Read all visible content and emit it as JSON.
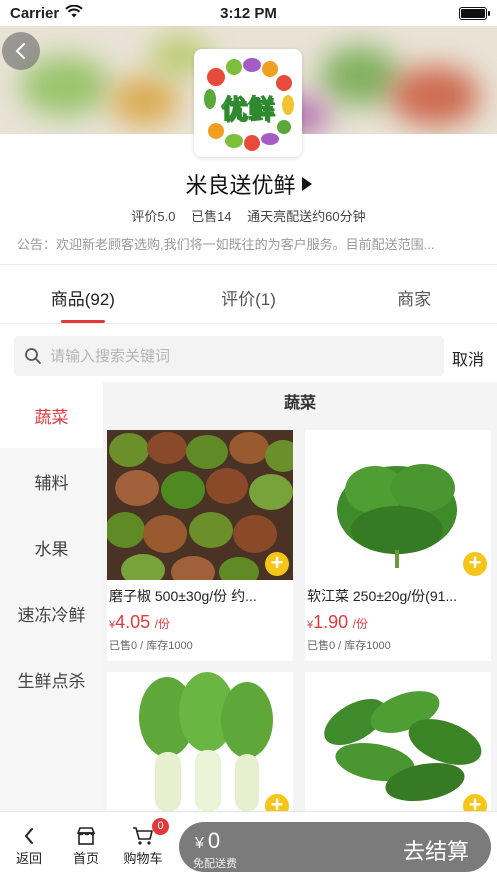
{
  "status_bar": {
    "carrier": "Carrier",
    "time": "3:12 PM"
  },
  "shop": {
    "logo_text": "优鲜",
    "name": "米良送优鲜",
    "rating": "评价5.0",
    "sold": "已售14",
    "delivery": "通天亮配送约60分钟",
    "notice": "公告：欢迎新老顾客选购,我们将一如既往的为客户服务。目前配送范围..."
  },
  "tabs": [
    {
      "label": "商品(92)",
      "active": true
    },
    {
      "label": "评价(1)",
      "active": false
    },
    {
      "label": "商家",
      "active": false
    }
  ],
  "search": {
    "placeholder": "请输入搜索关键词",
    "cancel": "取消"
  },
  "categories": [
    {
      "label": "蔬菜",
      "active": true
    },
    {
      "label": "辅料",
      "active": false
    },
    {
      "label": "水果",
      "active": false
    },
    {
      "label": "速冻冷鲜",
      "active": false
    },
    {
      "label": "生鲜点杀",
      "active": false
    }
  ],
  "current_category": "蔬菜",
  "products": [
    {
      "name": "磨子椒 500±30g/份 约...",
      "currency": "¥",
      "price": "4.05",
      "unit": "/份",
      "stock": "已售0 / 库存1000"
    },
    {
      "name": "软江菜 250±20g/份(91...",
      "currency": "¥",
      "price": "1.90",
      "unit": "/份",
      "stock": "已售0 / 库存1000"
    },
    {
      "name": "",
      "currency": "",
      "price": "",
      "unit": "",
      "stock": ""
    },
    {
      "name": "",
      "currency": "",
      "price": "",
      "unit": "",
      "stock": ""
    }
  ],
  "bottom_bar": {
    "back": "返回",
    "home": "首页",
    "cart": "购物车",
    "cart_count": "0",
    "currency": "¥",
    "total": "0",
    "free_delivery": "免配送费",
    "checkout": "去结算"
  },
  "colors": {
    "accent": "#e4393c",
    "plus": "#f5c518",
    "checkout_bg": "#7b7b7b"
  }
}
